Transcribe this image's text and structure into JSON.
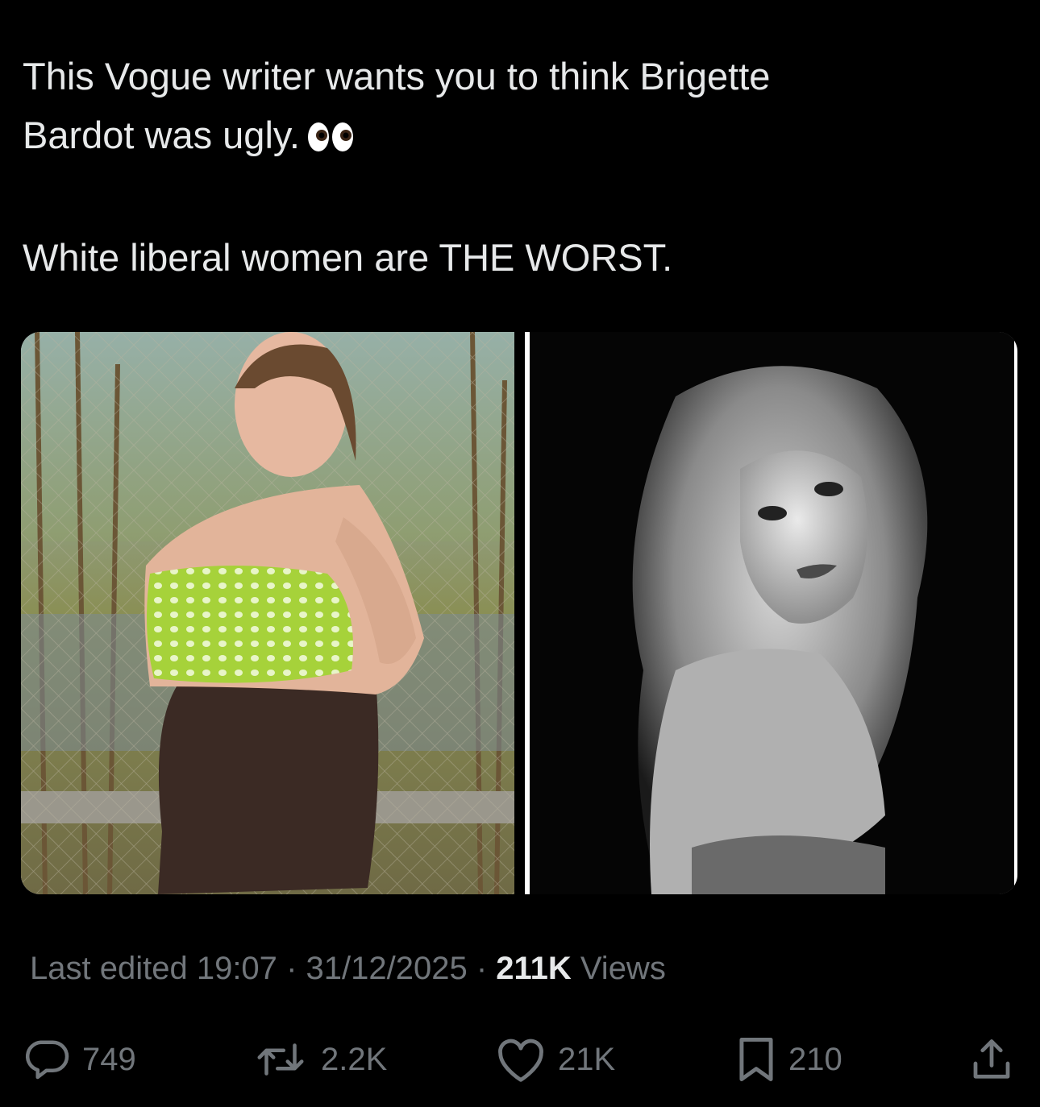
{
  "tweet": {
    "line1": "This Vogue writer wants you to think Brigette",
    "line2": "Bardot was ugly.",
    "emoji": "eyes-emoji",
    "line3": "White liberal women are THE WORST."
  },
  "media": {
    "left_image": "photo-woman-green-polka-dot-top",
    "right_image": "photo-black-white-portrait"
  },
  "meta": {
    "edited_label": "Last edited",
    "time": "19:07",
    "separator": "·",
    "date": "31/12/2025",
    "views_count": "211K",
    "views_label": "Views"
  },
  "actions": {
    "reply_count": "749",
    "repost_count": "2.2K",
    "like_count": "21K",
    "bookmark_count": "210"
  },
  "colors": {
    "background": "#000000",
    "text": "#e7e9ea",
    "muted": "#71767b"
  },
  "icons": [
    "reply-icon",
    "repost-icon",
    "like-icon",
    "bookmark-icon",
    "share-icon"
  ]
}
